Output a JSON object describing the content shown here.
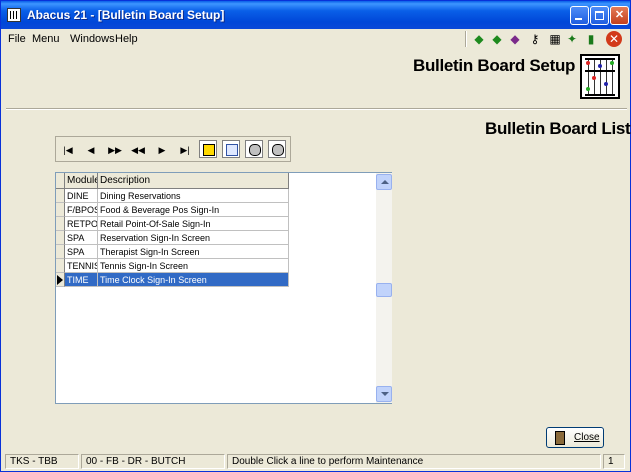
{
  "window": {
    "title": "Abacus 21 - [Bulletin Board Setup]"
  },
  "menu": {
    "items": [
      "File",
      "Menu",
      "Windows",
      "Help"
    ]
  },
  "toolbar_icons": [
    "back-arrow-icon",
    "forward-arrow-icon",
    "book-icon",
    "key-icon",
    "calculator-icon",
    "running-man-icon",
    "exit-door-icon",
    "close-red-icon"
  ],
  "header": {
    "page_title": "Bulletin Board Setup",
    "list_title": "Bulletin Board List"
  },
  "grid": {
    "columns": [
      "Module",
      "Description"
    ],
    "rows": [
      {
        "module": "DINE",
        "description": "Dining Reservations"
      },
      {
        "module": "F/BPOS",
        "description": "Food & Beverage Pos  Sign-In"
      },
      {
        "module": "RETPOS",
        "description": "Retail Point-Of-Sale Sign-In"
      },
      {
        "module": "SPA",
        "description": "Reservation Sign-In Screen"
      },
      {
        "module": "SPA",
        "description": "Therapist Sign-In Screen"
      },
      {
        "module": "TENNIS",
        "description": "Tennis Sign-In Screen"
      },
      {
        "module": "TIME",
        "description": "Time Clock Sign-In Screen"
      }
    ],
    "selected_index": 6
  },
  "buttons": {
    "close_label": "Close"
  },
  "statusbar": {
    "user": "TKS - TBB",
    "location": "00 - FB - DR - BUTCH",
    "hint": "Double Click a line to perform Maintenance",
    "page": "1"
  },
  "colors": {
    "title_bar": "#0a5fe8",
    "selection": "#316ac5",
    "background": "#ece9d8"
  }
}
